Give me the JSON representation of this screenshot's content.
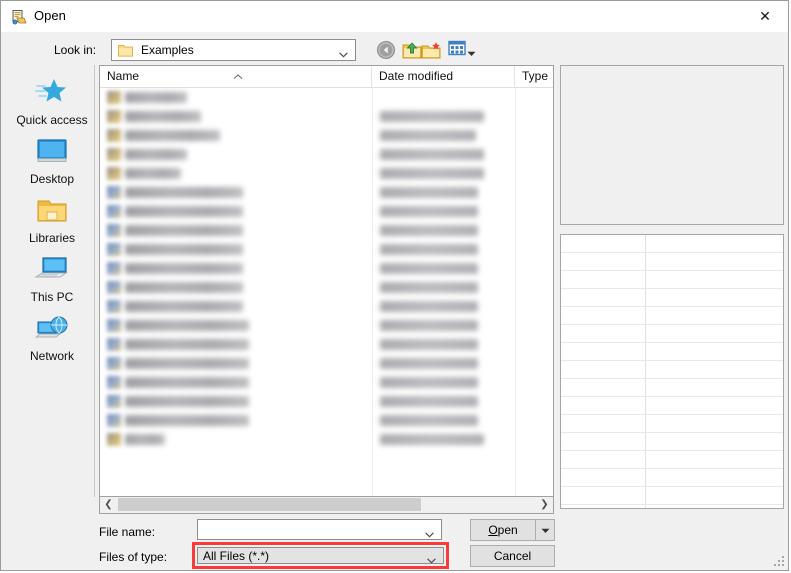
{
  "window": {
    "title": "Open",
    "icon": "open-file-dialog-icon",
    "close_label": "✕"
  },
  "toolbar": {
    "lookin_label": "Look in:",
    "lookin_value": "Examples",
    "buttons": [
      {
        "name": "back-button",
        "tooltip": "Back"
      },
      {
        "name": "up-one-level-button",
        "tooltip": "Up One Level"
      },
      {
        "name": "create-new-folder-button",
        "tooltip": "Create New Folder"
      },
      {
        "name": "views-button",
        "tooltip": "Views"
      }
    ]
  },
  "places": [
    {
      "label": "Quick access",
      "icon": "quick-access-star-icon"
    },
    {
      "label": "Desktop",
      "icon": "desktop-monitor-icon"
    },
    {
      "label": "Libraries",
      "icon": "libraries-folder-icon"
    },
    {
      "label": "This PC",
      "icon": "this-pc-computer-icon"
    },
    {
      "label": "Network",
      "icon": "network-globe-icon"
    }
  ],
  "filelist": {
    "columns": [
      "Name",
      "Date modified",
      "Type"
    ],
    "sort_column": "Name",
    "sort_direction": "ascending",
    "rows": [
      {
        "icon_kind": "folder",
        "name_w": 62,
        "date_w": 0,
        "type_w": 0
      },
      {
        "icon_kind": "folder",
        "name_w": 76,
        "date_w": 104,
        "type_w": 26
      },
      {
        "icon_kind": "folder",
        "name_w": 95,
        "date_w": 96,
        "type_w": 26
      },
      {
        "icon_kind": "folder",
        "name_w": 62,
        "date_w": 104,
        "type_w": 26
      },
      {
        "icon_kind": "folder",
        "name_w": 56,
        "date_w": 104,
        "type_w": 26
      },
      {
        "icon_kind": "file",
        "name_w": 118,
        "date_w": 98,
        "type_w": 28
      },
      {
        "icon_kind": "file",
        "name_w": 118,
        "date_w": 98,
        "type_w": 28
      },
      {
        "icon_kind": "file",
        "name_w": 118,
        "date_w": 98,
        "type_w": 28
      },
      {
        "icon_kind": "file",
        "name_w": 118,
        "date_w": 98,
        "type_w": 28
      },
      {
        "icon_kind": "file",
        "name_w": 118,
        "date_w": 98,
        "type_w": 28
      },
      {
        "icon_kind": "file",
        "name_w": 118,
        "date_w": 98,
        "type_w": 28
      },
      {
        "icon_kind": "file",
        "name_w": 118,
        "date_w": 98,
        "type_w": 28
      },
      {
        "icon_kind": "file",
        "name_w": 124,
        "date_w": 98,
        "type_w": 28
      },
      {
        "icon_kind": "file",
        "name_w": 124,
        "date_w": 98,
        "type_w": 28
      },
      {
        "icon_kind": "file",
        "name_w": 124,
        "date_w": 98,
        "type_w": 28
      },
      {
        "icon_kind": "file",
        "name_w": 124,
        "date_w": 98,
        "type_w": 28
      },
      {
        "icon_kind": "file",
        "name_w": 124,
        "date_w": 98,
        "type_w": 28
      },
      {
        "icon_kind": "file",
        "name_w": 124,
        "date_w": 98,
        "type_w": 28
      },
      {
        "icon_kind": "folder",
        "name_w": 40,
        "date_w": 104,
        "type_w": 0
      }
    ]
  },
  "preview": {
    "top_panel": "empty-preview-pane",
    "grid_rows": 16
  },
  "form": {
    "filename_label": "File name:",
    "filename_value": "",
    "filename_placeholder": "",
    "filetype_label": "Files of type:",
    "filetype_value": "All Files (*.*)",
    "filetype_highlighted": true,
    "highlight_color": "#fb3b3b"
  },
  "buttons": {
    "open_accel": "O",
    "open_rest": "pen",
    "open_dropdown_icon": "chevron-down-icon",
    "cancel_label": "Cancel"
  },
  "scrollbar": {
    "left_arrow": "❮",
    "right_arrow": "❯"
  }
}
